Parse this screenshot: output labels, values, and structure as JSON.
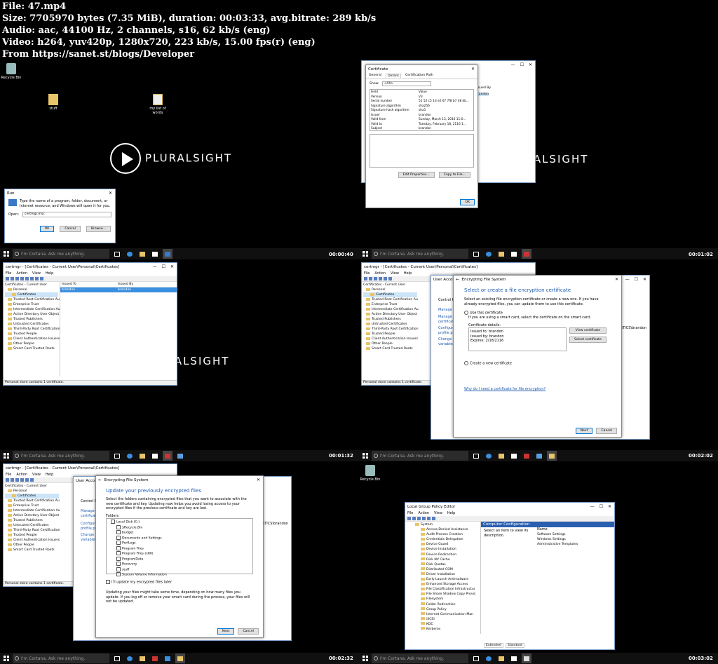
{
  "header": {
    "line1": "File: 47.mp4",
    "line2": "Size: 7705970 bytes (7.35 MiB), duration: 00:03:33, avg.bitrate: 289 kb/s",
    "line3": "Audio: aac, 44100 Hz, 2 channels, s16, 62 kb/s (eng)",
    "line4": "Video: h264, yuv420p, 1280x720, 223 kb/s, 15.00 fps(r) (eng)",
    "line5": "From https://sanet.st/blogs/Developer"
  },
  "taskbar": {
    "search_placeholder": "I'm Cortana. Ask me anything."
  },
  "logo": {
    "text": "PLURALSIGHT",
    "partial": "RALSIGHT"
  },
  "desktop": {
    "recycle_bin": "Recycle Bin",
    "stuff": "stuff",
    "list": "my list of words"
  },
  "timestamps": [
    "00:00:40",
    "00:01:02",
    "00:01:32",
    "00:02:02",
    "00:02:32",
    "00:03:02"
  ],
  "run_dialog": {
    "title": "Run",
    "desc": "Type the name of a program, folder, document, or Internet resource, and Windows will open it for you.",
    "open_label": "Open:",
    "value": "certmgr.msc",
    "ok": "OK",
    "cancel": "Cancel",
    "browse": "Browse..."
  },
  "certificate": {
    "title": "Certificate",
    "tabs": [
      "General",
      "Details",
      "Certification Path"
    ],
    "show_label": "Show:",
    "show_value": "<All>",
    "col_field": "Field",
    "col_value": "Value",
    "rows": [
      [
        "Version",
        "V3"
      ],
      [
        "Serial number",
        "51 52 c5 1d e2 67 7f8 b7 48 db..."
      ],
      [
        "Signature algorithm",
        "sha256"
      ],
      [
        "Signature hash algorithm",
        "sha1"
      ],
      [
        "Issuer",
        "brandon"
      ],
      [
        "Valid from",
        "Sunday, March 13, 2016 11:0..."
      ],
      [
        "Valid to",
        "Tuesday, February 18, 2116 1..."
      ],
      [
        "Subject",
        "brandon"
      ]
    ],
    "edit_props": "Edit Properties...",
    "copy_file": "Copy to File...",
    "ok": "OK",
    "bg_issued_by": "Issued By",
    "bg_brandon": "brandon"
  },
  "certmgr": {
    "title": "certmgr - [Certificates - Current User\\Personal\\Certificates]",
    "menu": [
      "File",
      "Action",
      "View",
      "Help"
    ],
    "tree": [
      "Certificates - Current User",
      "Personal",
      "Certificates",
      "Trusted Root Certification Au",
      "Enterprise Trust",
      "Intermediate Certification Au",
      "Active Directory User Object",
      "Trusted Publishers",
      "Untrusted Certificates",
      "Third-Party Root Certification",
      "Trusted People",
      "Client Authentication Issuers",
      "Other People",
      "Smart Card Trusted Roots"
    ],
    "col_issued_to": "Issued To",
    "col_issued_by": "Issued By",
    "row_to": "brandon",
    "row_by": "brandon",
    "status": "Personal store contains 1 certificate."
  },
  "efs_select": {
    "title": "Encrypting File System",
    "heading": "Select or create a file encryption certificate",
    "desc": "Select an existing file encryption certificate or create a new one. If you have already encrypted files, you can update them to use this certificate.",
    "use_this": "Use this certificate",
    "use_desc": "If you are using a smart card, select the certificate on the smart card.",
    "details_label": "Certificate details:",
    "issued_to": "Issued to: brandon",
    "issued_by": "Issued by: brandon",
    "expires": "Expires: 2/18/2116",
    "view": "View certificate",
    "select": "Select certificate",
    "create": "Create a new certificate",
    "why": "Why do I need a certificate for file encryption?",
    "next": "Next",
    "cancel": "Cancel",
    "bg_control": "Control P",
    "bg_manage": "Manage y",
    "bg_manage2": "Manage y certificate",
    "bg_config": "Configure profile pr",
    "bg_change": "Change m variables",
    "bg_user": "User Accounts",
    "bg_brandon": "\\TICS\\brandon"
  },
  "efs_update": {
    "title": "Encrypting File System",
    "heading": "Update your previously encrypted files",
    "desc": "Select the folders containing encrypted files that you want to associate with the new certificate and key. Updating now helps you avoid losing access to your encrypted files if the previous certificate and key are lost.",
    "folders_label": "Folders",
    "folders": [
      "Local Disk (C:)",
      "$Recycle.Bin",
      "budget",
      "Documents and Settings",
      "PerfLogs",
      "Program Files",
      "Program Files (x86)",
      "ProgramData",
      "Recovery",
      "stuff",
      "System Volume Information"
    ],
    "later": "I'll update my encrypted files later",
    "note": "Updating your files might take some time, depending on how many files you update. If you log off or remove your smart card during the process, your files will not be updated.",
    "next": "Next",
    "cancel": "Cancel"
  },
  "gpedit": {
    "title": "Local Group Policy Editor",
    "menu": [
      "File",
      "Action",
      "View",
      "Help"
    ],
    "tree": [
      "System",
      "Access-Denied Assistance",
      "Audit Process Creation",
      "Credentials Delegation",
      "Device Guard",
      "Device Installation",
      "Device Redirection",
      "Disk NV Cache",
      "Disk Quotas",
      "Distributed COM",
      "Driver Installation",
      "Early Launch Antimalware",
      "Enhanced Storage Access",
      "File Classification Infrastructur",
      "File Share Shadow Copy Provic",
      "Filesystem",
      "Folder Redirection",
      "Group Policy",
      "Internet Communication Man",
      "iSCSI",
      "KDC",
      "Kerberos"
    ],
    "pane_title": "Computer Configuration",
    "pane_desc": "Select an item to view its description.",
    "col_name": "Name",
    "items": [
      "Software Settings",
      "Windows Settings",
      "Administrative Templates"
    ],
    "tabs": [
      "Extended",
      "Standard"
    ]
  }
}
